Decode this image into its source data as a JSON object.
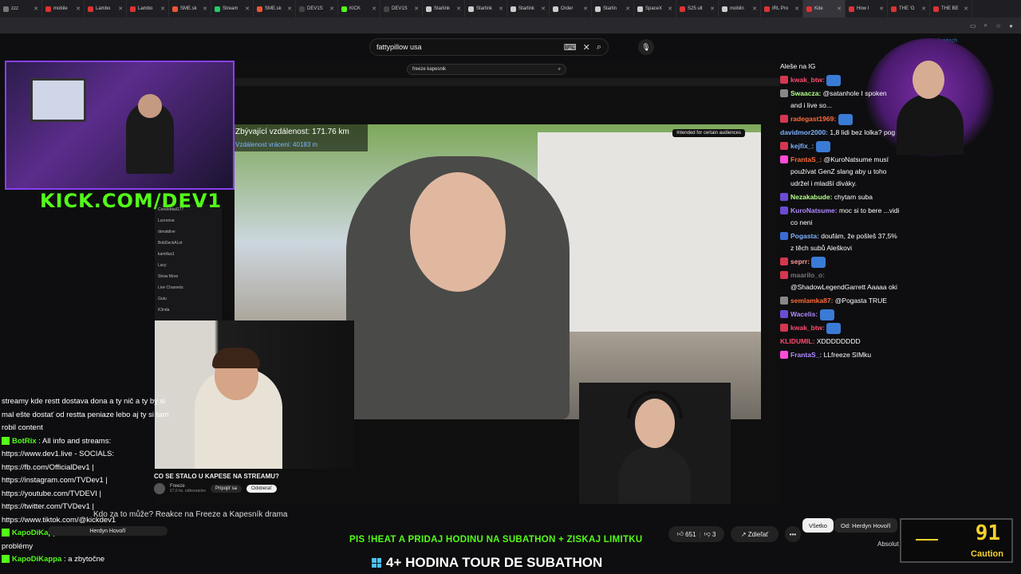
{
  "browser": {
    "tabs": [
      {
        "label": "zzz",
        "color": "#777"
      },
      {
        "label": "mobile",
        "color": "#d33"
      },
      {
        "label": "Lambo",
        "color": "#d33"
      },
      {
        "label": "Lambo",
        "color": "#d33"
      },
      {
        "label": "SME.sk",
        "color": "#e53"
      },
      {
        "label": "Stream",
        "color": "#2c6"
      },
      {
        "label": "SME.sk",
        "color": "#e53"
      },
      {
        "label": "DEV1S",
        "color": "#444"
      },
      {
        "label": "KICK",
        "color": "#53fc18"
      },
      {
        "label": "DEV1S",
        "color": "#444"
      },
      {
        "label": "Starlink",
        "color": "#ccc"
      },
      {
        "label": "Starlink",
        "color": "#ccc"
      },
      {
        "label": "Starlink",
        "color": "#ccc"
      },
      {
        "label": "Order",
        "color": "#ccc"
      },
      {
        "label": "Starlin",
        "color": "#ccc"
      },
      {
        "label": "SpaceX",
        "color": "#ccc"
      },
      {
        "label": "S25 ult",
        "color": "#d33"
      },
      {
        "label": "mobiln",
        "color": "#ccc"
      },
      {
        "label": "IRL Pro",
        "color": "#d33"
      },
      {
        "label": "Kde",
        "color": "#d33"
      },
      {
        "label": "How I",
        "color": "#d33"
      },
      {
        "label": "THE 'G",
        "color": "#d33"
      },
      {
        "label": "THE BE",
        "color": "#d33"
      }
    ],
    "active_tab": 19,
    "brand": "logitech"
  },
  "youtube_outer": {
    "search_value": "fattypillow usa"
  },
  "kick_logo": "KICK.COM/DEV1",
  "inner_browser": {
    "search_value": "freeze kapesnik",
    "search_placeholder": "Search",
    "audience_tag": "Intended for certain audiences",
    "distance_remaining": "Zbývající vzdálenost: 171.76 km",
    "distance_returned": "Vzdálenost vráceni: 40183 m",
    "sidebar": [
      "Condebtail177",
      "Lucrenva",
      "donatdive",
      "BobDeckALot",
      "kamillus1",
      "Lacy",
      "Show More",
      "Live Channels",
      "Gutu",
      "K3nda"
    ],
    "video_title": "CO SE STALO U KAPESE NA STREAMU?",
    "channel_name": "Freeze",
    "channel_subs": "67,6 tis. odberatelov",
    "join_label": "Pripojiť sa",
    "subscribe_label": "Odoberať"
  },
  "chat_right": [
    {
      "user": "",
      "text": "Aleše na IG",
      "color": "#fff",
      "badge": ""
    },
    {
      "user": "kwak_btw:",
      "text": "",
      "color": "#ff4b6e",
      "badge": "#d4374f"
    },
    {
      "user": "Swaacza:",
      "text": "@satanhole I spoken and i live so...",
      "color": "#b5ff8a",
      "badge": "#888"
    },
    {
      "user": "radegast1969:",
      "text": "",
      "color": "#ff6b3a",
      "badge": "#d4374f"
    },
    {
      "user": "davidmor2000:",
      "text": "1,8 lidi bez lolka? pog",
      "color": "#7eb3ff",
      "badge": ""
    },
    {
      "user": "kejfix_:",
      "text": "",
      "color": "#7eb3ff",
      "badge": "#d4374f"
    },
    {
      "user": "FrantaS_:",
      "text": "@KuroNatsume musí používat GenZ slang aby u toho udržel i mladší diváky.",
      "color": "#ff6b3a",
      "badge": "#ff4bd8"
    },
    {
      "user": "Nezakabude:",
      "text": "chytam suba",
      "color": "#b5ff8a",
      "badge": "#6b4bd4"
    },
    {
      "user": "KuroNatsume:",
      "text": "moc si to bere ...vidi co neni",
      "color": "#b08aff",
      "badge": "#6b4bd4"
    },
    {
      "user": "Pogasta:",
      "text": "doufám, že pošleš 37,5% z těch subů Aleškovi",
      "color": "#7eb3ff",
      "badge": "#3a6bd4"
    },
    {
      "user": "seprr:",
      "text": "",
      "color": "#ff9a9a",
      "badge": "#d4374f"
    },
    {
      "user": "maarilo_o:",
      "text": "@ShadowLegendGarrett Aaaaa oki",
      "color": "#777",
      "badge": "#d4374f"
    },
    {
      "user": "semlamka87:",
      "text": "@Pogasta TRUE",
      "color": "#ff6b3a",
      "badge": "#888"
    },
    {
      "user": "Wacelis:",
      "text": "",
      "color": "#b08aff",
      "badge": "#6b4bd4"
    },
    {
      "user": "kwak_btw:",
      "text": "",
      "color": "#ff4b6e",
      "badge": "#d4374f"
    },
    {
      "user": "KLIDUMIL:",
      "text": "XDDDDDDDD",
      "color": "#ff4b6e",
      "badge": ""
    },
    {
      "user": "FrantaS_:",
      "text": "LLfreeze SIMku",
      "color": "#b08aff",
      "badge": "#ff4bd8"
    }
  ],
  "chat_left": [
    {
      "user": "",
      "text": "streamy kde restt dostava dona a ty nič a ty by si mal ešte dostať od restta peniaze lebo aj ty si tam robil content"
    },
    {
      "user": "BotRix",
      "text": ": All info and streams: https://www.dev1.live - SOCIALS: https://fb.com/OfficialDev1 | https://instagram.com/TVDev1 | https://youtube.com/TVDEVI | https://twitter.com/TVDev1 | https://www.tiktok.com/@kickdev1"
    },
    {
      "user": "KapoDiKappa",
      "text": ": mamka mu akurát narobila problémy"
    },
    {
      "user": "KapoDiKappa",
      "text": ": a zbytočne"
    }
  ],
  "overlay": {
    "reakce": "Kdo za to může? Reakce na Freeze a Kapesník drama",
    "herdyn": "Herdyn Hovoří",
    "subathon_ticker": "PIS !HEAT A PRIDAJ HODINU NA SUBATHON + ZISKAJ LIMITKU",
    "bottom_title": "4+ HODINA TOUR DE SUBATHON"
  },
  "youtube_actions": {
    "likes": "651",
    "dislikes": "3",
    "share": "Zdieľať",
    "more": "•••",
    "chip_all": "Všetko",
    "chip_from": "Od: Herdyn Hovoří",
    "absolut": "Absolut"
  },
  "gauge": {
    "value": "91",
    "label": "Caution"
  }
}
